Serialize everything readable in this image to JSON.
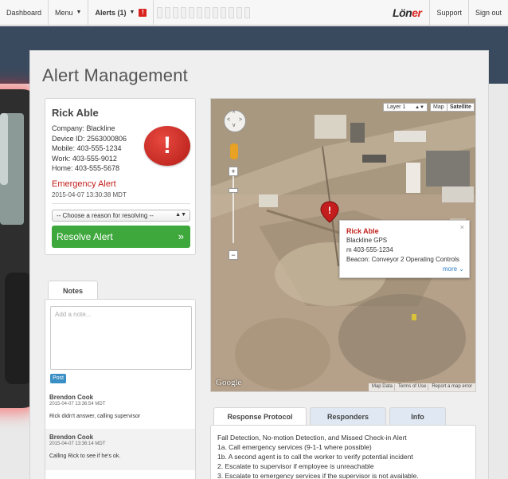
{
  "topnav": {
    "items": [
      "Dashboard",
      "Menu",
      "Alerts (1)"
    ],
    "alert_badge": "!",
    "brand_main": "Lön",
    "brand_accent": "er",
    "support": "Support",
    "sign_out": "Sign out"
  },
  "page": {
    "title": "Alert Management"
  },
  "alert": {
    "name": "Rick Able",
    "company": "Company: Blackline",
    "device_id": "Device ID: 2563000806",
    "mobile": "Mobile: 403-555-1234",
    "work": "Work: 403-555-9012",
    "home": "Home: 403-555-5678",
    "icon": "!",
    "type": "Emergency Alert",
    "time": "2015-04-07 13:30:38 MDT",
    "resolve_select": "-- Choose a reason for resolving --",
    "resolve_button": "Resolve Alert",
    "resolve_chevron": "»"
  },
  "notes": {
    "tab": "Notes",
    "placeholder": "Add a note...",
    "post": "Post",
    "items": [
      {
        "author": "Brendon Cook",
        "time": "2015-04-07 13:36:54 MDT",
        "text": "Rick didn't answer, calling supervisor"
      },
      {
        "author": "Brendon Cook",
        "time": "2015-04-07 13:36:14 MDT",
        "text": "Calling Rick to see if he's ok."
      }
    ]
  },
  "map": {
    "layer": "Layer 1",
    "map_type": "Map",
    "satellite_type": "Satellite",
    "zoom_in": "+",
    "zoom_out": "−",
    "popup": {
      "name": "Rick Able",
      "source": "Blackline GPS",
      "phone": "m 403-555-1234",
      "beacon": "Beacon: Conveyor 2 Operating Controls",
      "more": "more ⌄",
      "close": "×"
    },
    "logo": "Google",
    "attribution": [
      "Map Data",
      "Terms of Use",
      "Report a map error"
    ]
  },
  "tabs": [
    "Response Protocol",
    "Responders",
    "Info"
  ],
  "protocol": {
    "lines": [
      "Fall Detection, No-motion Detection, and Missed Check-in Alert",
      "1a. Call emergency services (9-1-1 where possible)",
      "1b. A second agent is to call the worker to verify potential incident",
      "2. Escalate to supervisor if employee is unreachable",
      "3. Escalate to emergency services if the supervisor is not available."
    ]
  }
}
